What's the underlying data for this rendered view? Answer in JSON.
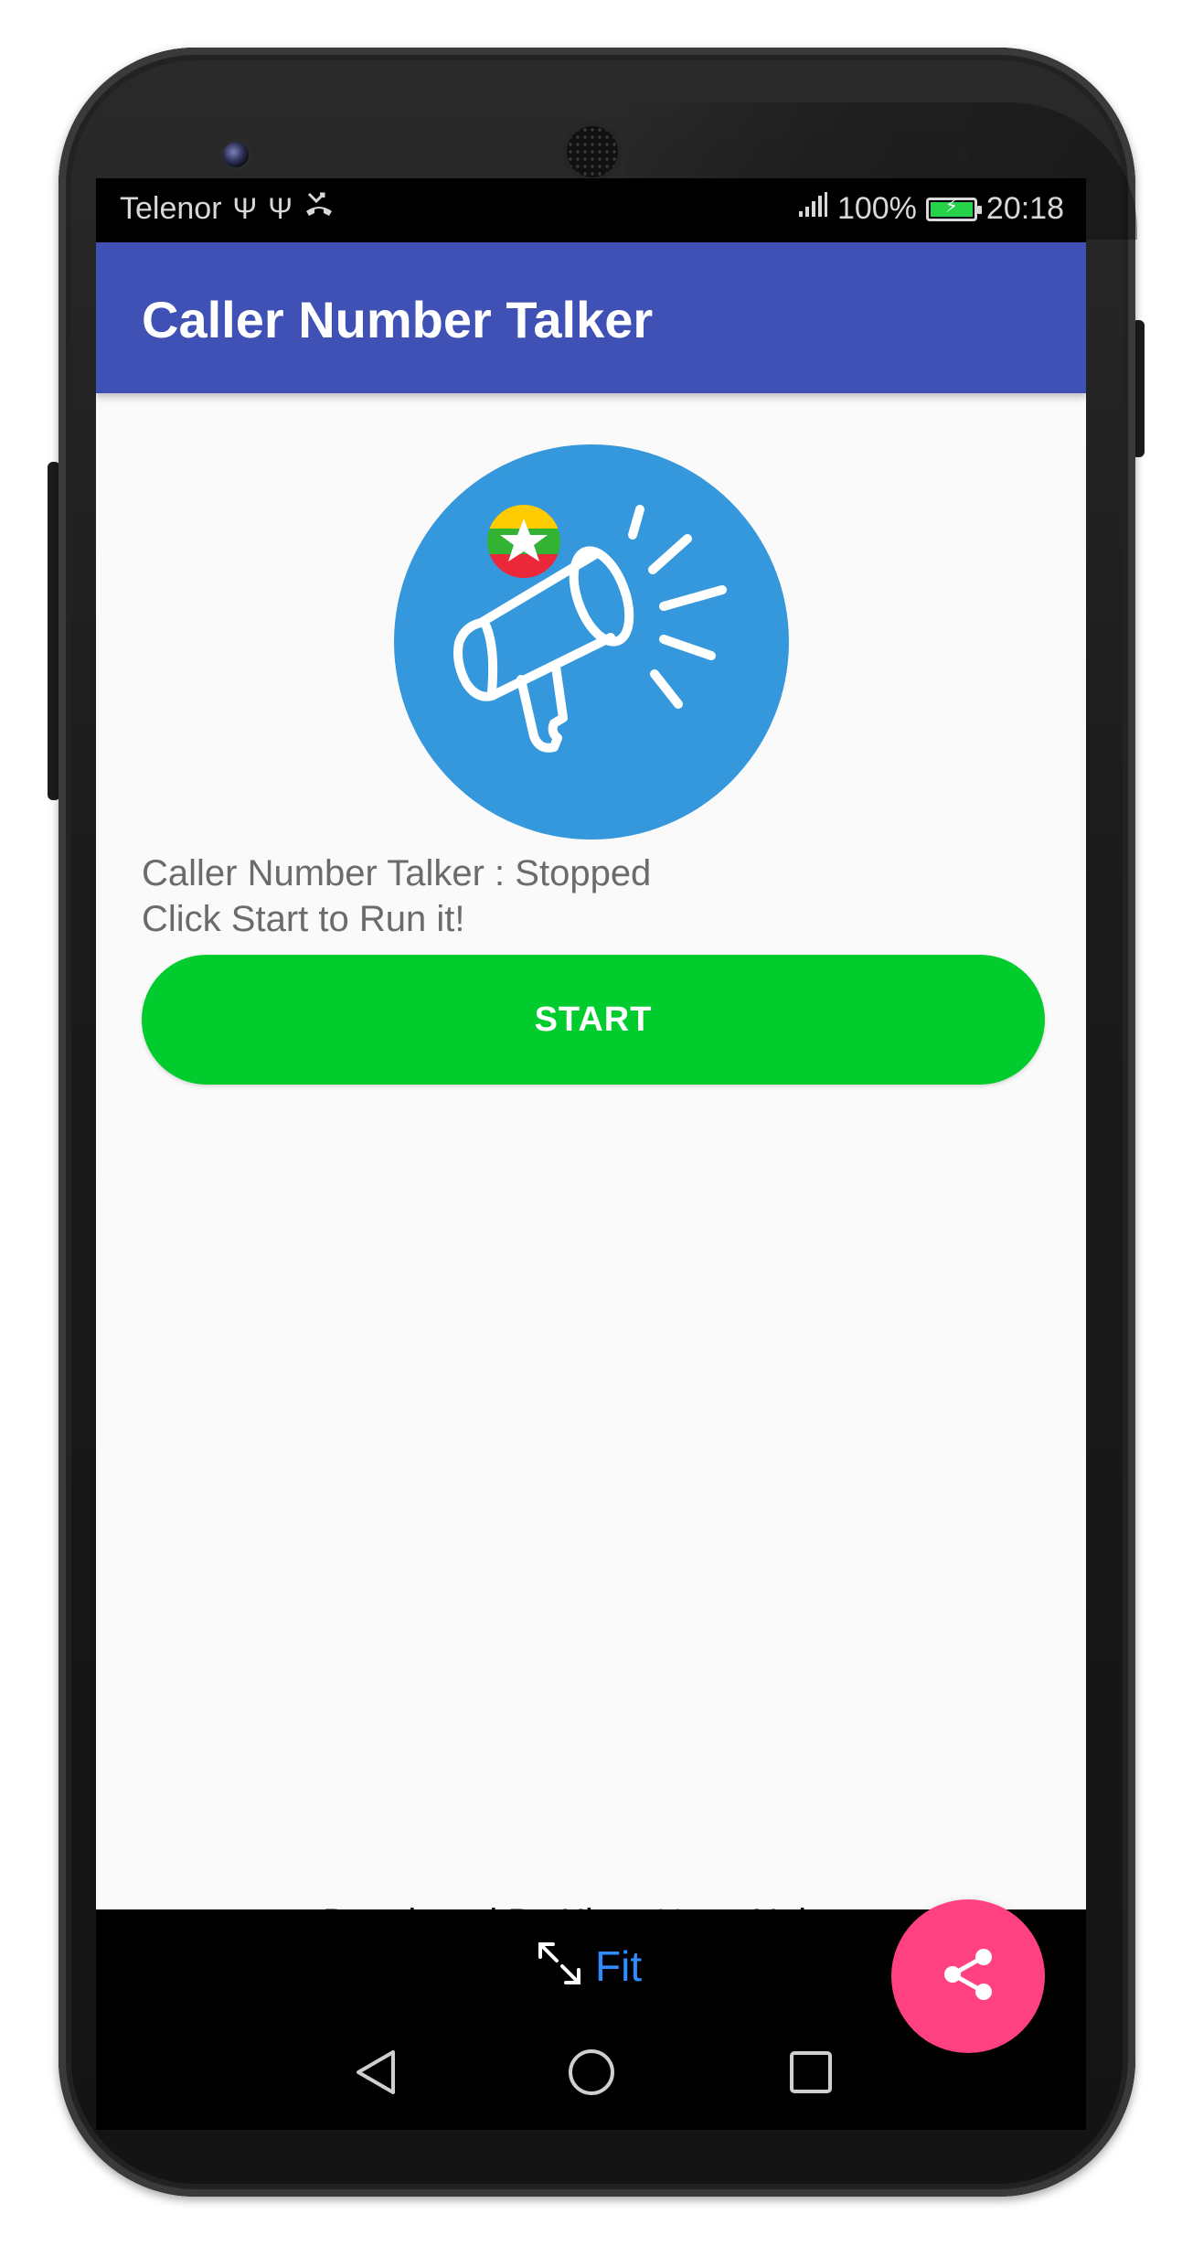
{
  "status_bar": {
    "carrier": "Telenor",
    "usb_icon_1": "usb-icon",
    "usb_icon_2": "usb-icon",
    "missed_call_icon": "missed-call-icon",
    "signal_icon": "signal-bars-icon",
    "battery_percent": "100%",
    "battery_icon": "charging-battery-icon",
    "time": "20:18"
  },
  "app_bar": {
    "title": "Caller Number Talker"
  },
  "main": {
    "logo_icon": "megaphone-with-myanmar-flag-icon",
    "status_line_1": "Caller Number Talker : Stopped",
    "status_line_2": "Click Start to Run it!",
    "start_label": "START",
    "developer_credit": "Developed By Khun Htetz Naing",
    "share_icon": "share-icon"
  },
  "emulator_bar": {
    "fit_icon": "resize-arrows-icon",
    "fit_label": "Fit"
  },
  "navigation": {
    "back_icon": "back-triangle-icon",
    "home_icon": "home-circle-icon",
    "recents_icon": "recents-square-icon"
  },
  "colors": {
    "app_bar": "#3f51b5",
    "start_button": "#00cc2e",
    "fab": "#ff4081",
    "logo_circle": "#3597dc",
    "fit_label": "#2f8cff"
  }
}
